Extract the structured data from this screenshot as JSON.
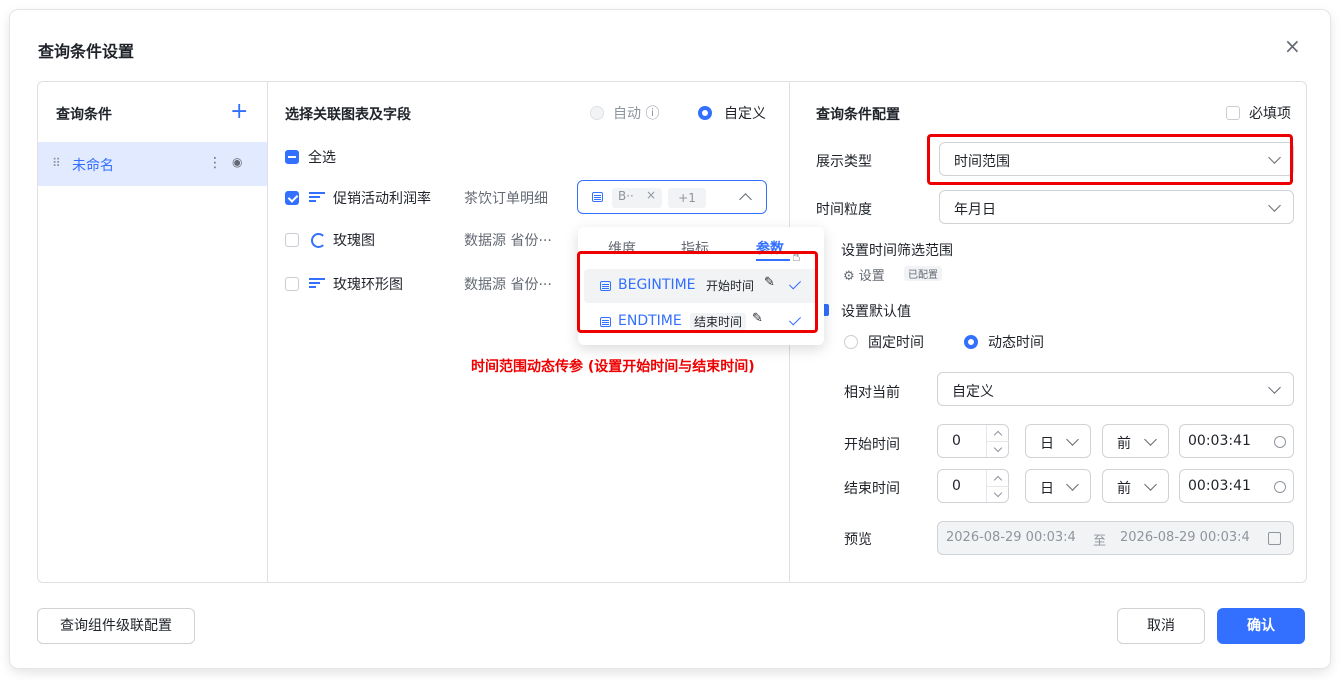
{
  "dialog": {
    "title": "查询条件设置",
    "close": "×"
  },
  "left": {
    "header": "查询条件",
    "add": "+",
    "item": {
      "handle": "⠿",
      "name": "未命名",
      "more": "⋮",
      "eye": "◉"
    }
  },
  "mid": {
    "header": "选择关联图表及字段",
    "mode": {
      "auto": "自动",
      "info": "ⓘ",
      "custom": "自定义"
    },
    "select_all": "全选",
    "rows": [
      {
        "name": "促销活动利润率",
        "source": "茶饮订单明细"
      },
      {
        "name": "玫瑰图",
        "source": "数据源 省份···"
      },
      {
        "name": "玫瑰环形图",
        "source": "数据源 省份···"
      }
    ],
    "field_select": {
      "tag": "B··",
      "tag_close": "×",
      "more": "+1"
    },
    "popup": {
      "tabs": [
        "维度",
        "指标",
        "参数"
      ],
      "items": [
        {
          "name": "BEGINTIME",
          "alias": "开始时间"
        },
        {
          "name": "ENDTIME",
          "alias": "结束时间"
        }
      ]
    },
    "annotation": "时间范围动态传参 (设置开始时间与结束时间)"
  },
  "right": {
    "header": "查询条件配置",
    "required": "必填项",
    "display_type": {
      "label": "展示类型",
      "value": "时间范围"
    },
    "granularity": {
      "label": "时间粒度",
      "value": "年月日"
    },
    "filter_range": {
      "label": "设置时间筛选范围",
      "link": "设置",
      "tag": "已配置"
    },
    "default": {
      "label": "设置默认值",
      "fixed": "固定时间",
      "dynamic": "动态时间"
    },
    "relative": {
      "label": "相对当前",
      "value": "自定义"
    },
    "start": {
      "label": "开始时间",
      "num": "0",
      "unit": "日",
      "dir": "前",
      "time": "00:03:41"
    },
    "end": {
      "label": "结束时间",
      "num": "0",
      "unit": "日",
      "dir": "前",
      "time": "00:03:41"
    },
    "preview": {
      "label": "预览",
      "from": "2026-08-29 00:03:4",
      "sep": "至",
      "to": "2026-08-29 00:03:4"
    }
  },
  "footer": {
    "cascade": "查询组件级联配置",
    "cancel": "取消",
    "ok": "确认"
  },
  "colors": {
    "accent": "#3370ff",
    "annotation": "#ee0000"
  }
}
